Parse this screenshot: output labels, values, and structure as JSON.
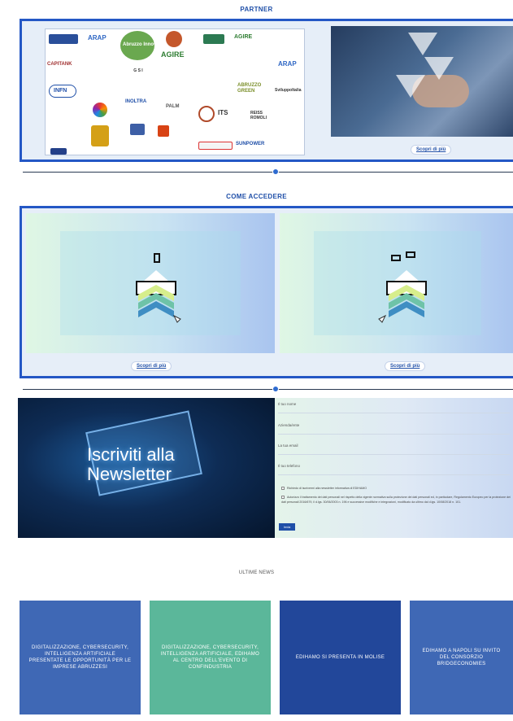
{
  "partner": {
    "title": "PARTNER",
    "cta": "Scopri di più",
    "logos": [
      "ARAP",
      "Abruzzo Innova",
      "AGIRE",
      "AGIRE",
      "CAPITANK",
      "G S I",
      "ARAP",
      "INFN",
      "ABRUZZO GREEN",
      "Sviluppoltalia",
      "INOLTRA",
      "PALM",
      "ITS",
      "REISS ROMOLI",
      "SUNPOWER"
    ]
  },
  "access": {
    "title": "COME ACCEDERE",
    "cards": [
      {
        "cta": "Scopri di più"
      },
      {
        "cta": "Scopri di più"
      }
    ]
  },
  "newsletter": {
    "image_text": "Iscriviti alla Newsletter",
    "fields": {
      "name": "Il tuo nome",
      "company": "Azienda/ente",
      "email": "La tua email",
      "phone": "Il tuo telefono"
    },
    "consent_1": "Richiedo di iscrivermi alla newsletter informativa di EDIHAMO",
    "consent_2": "Autorizzo il trattamento dei dati personali nel rispetto della vigente normativa sulla protezione dei dati personali ed, in particolare, Regolamento Europeo per la protezione dei dati personali 2016/679, il d.lgs. 30/06/2003 n. 196 e successive modifiche e integrazioni, modificato da ultimo dal d.lgs. 10/08/2018 n. 101.",
    "submit": "Invia"
  },
  "news": {
    "heading": "ULTIME NEWS",
    "items": [
      {
        "title": "DIGITALIZZAZIONE, CYBERSECURITY, INTELLIGENZA ARTIFICIALE PRESENTATE LE OPPORTUNITÀ PER LE IMPRESE ABRUZZESI",
        "color": "#3f68b5"
      },
      {
        "title": "DIGITALIZZAZIONE, CYBERSECURITY, INTELLIGENZA ARTIFICIALE, EDIHAMO AL CENTRO DELL'EVENTO DI CONFINDUSTRIA",
        "color": "#5bb79a"
      },
      {
        "title": "EDIHAMO SI PRESENTA IN MOLISE",
        "color": "#22479a"
      },
      {
        "title": "EDIHAMO A NAPOLI SU INVITO DEL CONSORZIO BRIDGECONOMIES",
        "color": "#3f68b5"
      }
    ]
  },
  "colors": {
    "brand_blue": "#2457c5",
    "panel_bg": "#e6eef8"
  }
}
